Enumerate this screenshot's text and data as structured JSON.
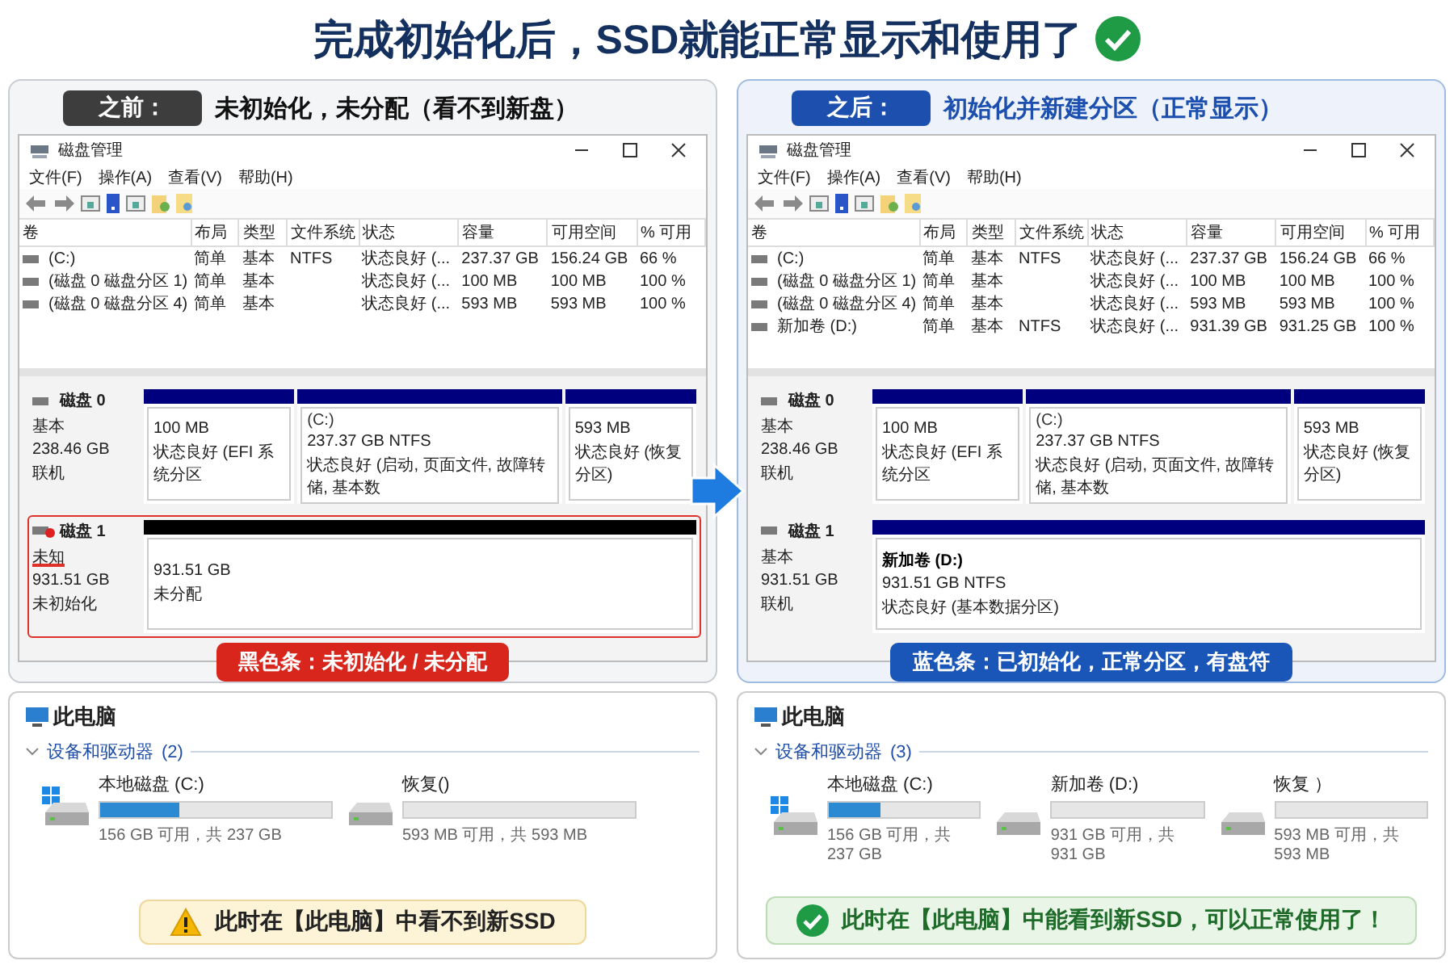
{
  "title": "完成初始化后，SSD就能正常显示和使用了",
  "panels": [
    {
      "kind": "before",
      "badge": "之前：",
      "heading": "未初始化，未分配（看不到新盘）",
      "window": {
        "title": "磁盘管理",
        "menu": [
          "文件(F)",
          "操作(A)",
          "查看(V)",
          "帮助(H)"
        ],
        "columns": [
          "卷",
          "布局",
          "类型",
          "文件系统",
          "状态",
          "容量",
          "可用空间",
          "% 可用"
        ],
        "rows": [
          [
            "(C:)",
            "简单",
            "基本",
            "NTFS",
            "状态良好 (...",
            "237.37 GB",
            "156.24 GB",
            "66 %"
          ],
          [
            "(磁盘 0 磁盘分区 1)",
            "简单",
            "基本",
            "",
            "状态良好 (...",
            "100 MB",
            "100 MB",
            "100 %"
          ],
          [
            "(磁盘 0 磁盘分区 4)",
            "简单",
            "基本",
            "",
            "状态良好 (...",
            "593 MB",
            "593 MB",
            "100 %"
          ]
        ],
        "disks": [
          {
            "name": "磁盘 0",
            "error": false,
            "highlighted": false,
            "info": [
              "基本",
              "238.46 GB",
              "联机"
            ],
            "partitions": [
              {
                "color": "#00007f",
                "lines": [
                  "100 MB",
                  "状态良好 (EFI 系统分区"
                ]
              },
              {
                "color": "#00007f",
                "bold": false,
                "name": "(C:)",
                "lines": [
                  "237.37 GB NTFS",
                  "状态良好 (启动, 页面文件, 故障转储, 基本数"
                ]
              },
              {
                "color": "#00007f",
                "lines": [
                  "593 MB",
                  "状态良好 (恢复分区)"
                ]
              }
            ]
          },
          {
            "name": "磁盘 1",
            "error": true,
            "highlighted": true,
            "info": [
              "未知",
              "931.51 GB",
              "未初始化"
            ],
            "partitions": [
              {
                "color": "#000000",
                "lines": [
                  "931.51 GB",
                  "未分配"
                ]
              }
            ]
          }
        ]
      },
      "callout": "黑色条：未初始化 / 未分配"
    },
    {
      "kind": "after",
      "badge": "之后：",
      "heading": "初始化并新建分区（正常显示）",
      "window": {
        "title": "磁盘管理",
        "menu": [
          "文件(F)",
          "操作(A)",
          "查看(V)",
          "帮助(H)"
        ],
        "columns": [
          "卷",
          "布局",
          "类型",
          "文件系统",
          "状态",
          "容量",
          "可用空间",
          "% 可用"
        ],
        "rows": [
          [
            "(C:)",
            "简单",
            "基本",
            "NTFS",
            "状态良好 (...",
            "237.37 GB",
            "156.24 GB",
            "66 %"
          ],
          [
            "(磁盘 0 磁盘分区 1)",
            "简单",
            "基本",
            "",
            "状态良好 (...",
            "100 MB",
            "100 MB",
            "100 %"
          ],
          [
            "(磁盘 0 磁盘分区 4)",
            "简单",
            "基本",
            "",
            "状态良好 (...",
            "593 MB",
            "593 MB",
            "100 %"
          ],
          [
            "新加卷 (D:)",
            "简单",
            "基本",
            "NTFS",
            "状态良好 (...",
            "931.39 GB",
            "931.25 GB",
            "100 %"
          ]
        ],
        "disks": [
          {
            "name": "磁盘 0",
            "error": false,
            "highlighted": false,
            "info": [
              "基本",
              "238.46 GB",
              "联机"
            ],
            "partitions": [
              {
                "color": "#00007f",
                "lines": [
                  "100 MB",
                  "状态良好 (EFI 系统分区"
                ]
              },
              {
                "color": "#00007f",
                "bold": false,
                "name": "(C:)",
                "lines": [
                  "237.37 GB NTFS",
                  "状态良好 (启动, 页面文件, 故障转储, 基本数"
                ]
              },
              {
                "color": "#00007f",
                "lines": [
                  "593 MB",
                  "状态良好 (恢复分区)"
                ]
              }
            ]
          },
          {
            "name": "磁盘 1",
            "error": false,
            "highlighted": false,
            "info": [
              "基本",
              "931.51 GB",
              "联机"
            ],
            "partitions": [
              {
                "color": "#00007f",
                "bold": true,
                "name": "新加卷 (D:)",
                "lines": [
                  "931.51 GB NTFS",
                  "状态良好 (基本数据分区)"
                ]
              }
            ]
          }
        ]
      },
      "callout": "蓝色条：已初始化，正常分区，有盘符"
    }
  ],
  "explorers": [
    {
      "title": "此电脑",
      "group": "设备和驱动器",
      "count": "(2)",
      "drives": [
        {
          "name": "本地磁盘 (C:)",
          "system": true,
          "level": 0.34,
          "free": "156 GB 可用，共 237 GB"
        },
        {
          "name": "恢复()",
          "system": false,
          "level": 0,
          "free": "593 MB 可用，共 593 MB"
        }
      ],
      "notice": {
        "kind": "warning",
        "text": "此时在【此电脑】中看不到新SSD"
      }
    },
    {
      "title": "此电脑",
      "group": "设备和驱动器",
      "count": "(3)",
      "drives": [
        {
          "name": "本地磁盘 (C:)",
          "system": true,
          "level": 0.34,
          "free": "156 GB 可用，共 237 GB"
        },
        {
          "name": "新加卷 (D:)",
          "system": false,
          "level": 0,
          "free": "931 GB 可用，共 931 GB"
        },
        {
          "name": "恢复 ）",
          "system": false,
          "level": 0,
          "free": "593 MB 可用，共 593 MB"
        }
      ],
      "notice": {
        "kind": "ok",
        "text": "此时在【此电脑】中能看到新SSD，可以正常使用了！"
      }
    }
  ]
}
